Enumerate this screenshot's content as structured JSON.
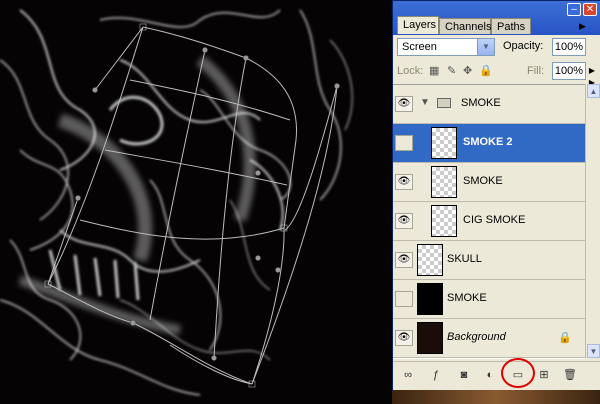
{
  "panel": {
    "tabs": [
      {
        "label": "Layers"
      },
      {
        "label": "Channels"
      },
      {
        "label": "Paths"
      }
    ],
    "blend_mode": "Screen",
    "opacity_label": "Opacity:",
    "opacity_value": "100%",
    "lock_label": "Lock:",
    "fill_label": "Fill:",
    "fill_value": "100%",
    "layers": [
      {
        "name": "SMOKE",
        "type": "group",
        "visible": true,
        "selected": false
      },
      {
        "name": "SMOKE 2",
        "type": "layer",
        "visible": false,
        "selected": true
      },
      {
        "name": "SMOKE",
        "type": "layer",
        "visible": true,
        "selected": false
      },
      {
        "name": "CIG SMOKE",
        "type": "layer",
        "visible": true,
        "selected": false
      },
      {
        "name": "SKULL",
        "type": "layer",
        "visible": true,
        "selected": false
      },
      {
        "name": "SMOKE",
        "type": "layer",
        "visible": false,
        "selected": false
      },
      {
        "name": "Background",
        "type": "background",
        "visible": true,
        "selected": false,
        "locked": true
      }
    ],
    "bottom_icons": [
      "link-icon",
      "fx-icon",
      "mask-icon",
      "adjustment-icon",
      "new-group-icon",
      "new-layer-icon",
      "trash-icon"
    ]
  },
  "colors": {
    "selection": "#316ac5",
    "panel_bg": "#ece9d8",
    "titlebar": "#2754c4",
    "highlight_circle": "#e00000"
  }
}
